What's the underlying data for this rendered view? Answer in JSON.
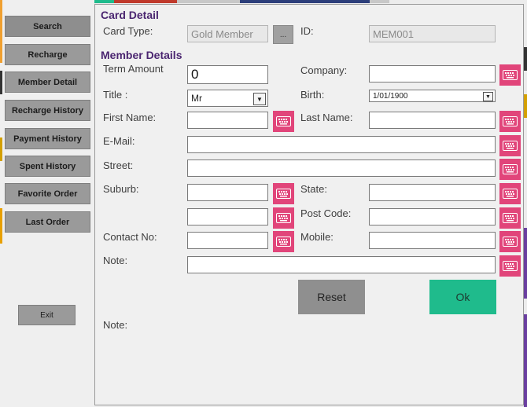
{
  "sidebar": {
    "items": [
      {
        "id": "search",
        "label": "Search"
      },
      {
        "id": "recharge",
        "label": "Recharge"
      },
      {
        "id": "member-detail",
        "label": "Member Detail"
      },
      {
        "id": "recharge-history",
        "label": "Recharge History"
      },
      {
        "id": "payment-history",
        "label": "Payment History"
      },
      {
        "id": "spent-history",
        "label": "Spent History"
      },
      {
        "id": "favorite-order",
        "label": "Favorite Order"
      },
      {
        "id": "last-order",
        "label": "Last Order"
      }
    ],
    "exit_label": "Exit"
  },
  "card_detail": {
    "title": "Card Detail",
    "card_type_label": "Card Type:",
    "card_type_value": "Gold Member",
    "browse_label": "...",
    "id_label": "ID:",
    "id_value": "MEM001"
  },
  "member": {
    "title": "Member Details",
    "term_amount_label": "Term Amount",
    "term_amount_value": "0",
    "company_label": "Company:",
    "company_value": "",
    "title_label": "Title :",
    "title_value": "Mr",
    "birth_label": "Birth:",
    "birth_value": "1/01/1900",
    "first_name_label": "First Name:",
    "first_name_value": "",
    "last_name_label": "Last Name:",
    "last_name_value": "",
    "email_label": "E-Mail:",
    "email_value": "",
    "street_label": "Street:",
    "street_value": "",
    "suburb_label": "Suburb:",
    "suburb_value": "",
    "state_label": "State:",
    "state_value": "",
    "suburb2_value": "",
    "postcode_label": "Post Code:",
    "postcode_value": "",
    "contact_label": "Contact No:",
    "contact_value": "",
    "mobile_label": "Mobile:",
    "mobile_value": "",
    "note_label": "Note:",
    "note_value": "",
    "note2_label": "Note:"
  },
  "actions": {
    "reset_label": "Reset",
    "ok_label": "Ok"
  },
  "colors": {
    "accent_heading": "#4a2570",
    "keyboard_button": "#e1457a",
    "ok_button": "#1fbb8c",
    "reset_button": "#8f8f8f"
  }
}
